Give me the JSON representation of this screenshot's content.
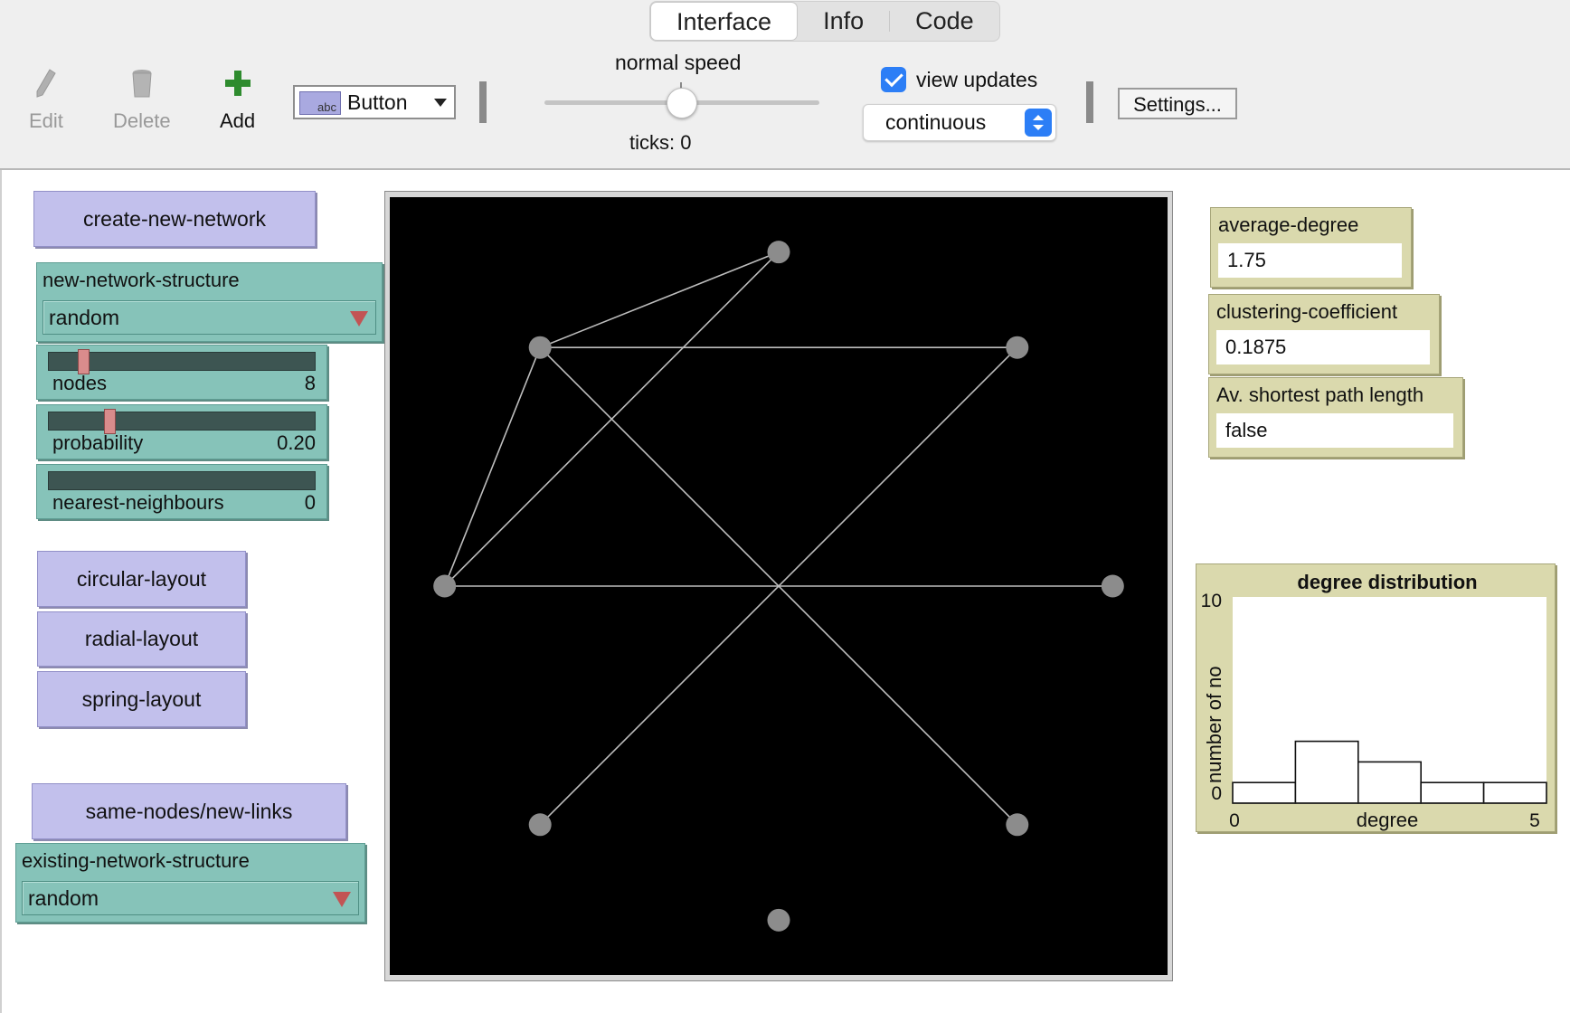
{
  "tabs": [
    {
      "label": "Interface"
    },
    {
      "label": "Info"
    },
    {
      "label": "Code"
    }
  ],
  "toolbar": {
    "edit_label": "Edit",
    "delete_label": "Delete",
    "add_label": "Add",
    "widget_type": "Button",
    "speed_label": "normal speed",
    "speed_value": 0.5,
    "ticks_label": "ticks: 0",
    "view_updates_label": "view updates",
    "view_updates_checked": true,
    "update_mode": "continuous",
    "settings_label": "Settings..."
  },
  "widgets": {
    "create_button": "create-new-network",
    "new_structure": {
      "label": "new-network-structure",
      "value": "random"
    },
    "nodes": {
      "label": "nodes",
      "value": "8",
      "position": 0.1
    },
    "probability": {
      "label": "probability",
      "value": "0.20",
      "position": 0.2
    },
    "nearest": {
      "label": "nearest-neighbours",
      "value": "0",
      "position": 0.0
    },
    "circular_button": "circular-layout",
    "radial_button": "radial-layout",
    "spring_button": "spring-layout",
    "same_nodes_button": "same-nodes/new-links",
    "existing_structure": {
      "label": "existing-network-structure",
      "value": "random"
    }
  },
  "monitors": {
    "average_degree": {
      "label": "average-degree",
      "value": "1.75"
    },
    "clustering": {
      "label": "clustering-coefficient",
      "value": "0.1875"
    },
    "shortest_path": {
      "label": "Av. shortest path length",
      "value": "false"
    }
  },
  "network": {
    "node_color": "#8c8c8c",
    "link_color": "#bdbdbd",
    "nodes": [
      {
        "id": "n-top",
        "x": 0.0,
        "y": 14.0
      },
      {
        "id": "n-upper-left",
        "x": -10.0,
        "y": 10.0
      },
      {
        "id": "n-upper-right",
        "x": 10.0,
        "y": 10.0
      },
      {
        "id": "n-left",
        "x": -14.0,
        "y": 0.0
      },
      {
        "id": "n-right",
        "x": 14.0,
        "y": 0.0
      },
      {
        "id": "n-lower-left",
        "x": -10.0,
        "y": -10.0
      },
      {
        "id": "n-lower-right",
        "x": 10.0,
        "y": -10.0
      },
      {
        "id": "n-bottom",
        "x": 0.0,
        "y": -14.0
      }
    ],
    "links": [
      [
        "n-top",
        "n-upper-left"
      ],
      [
        "n-top",
        "n-left"
      ],
      [
        "n-upper-left",
        "n-upper-right"
      ],
      [
        "n-upper-left",
        "n-left"
      ],
      [
        "n-upper-left",
        "n-lower-right"
      ],
      [
        "n-upper-right",
        "n-lower-left"
      ],
      [
        "n-left",
        "n-right"
      ]
    ]
  },
  "chart_data": {
    "type": "bar",
    "title": "degree distribution",
    "xlabel": "degree",
    "ylabel": "number of nodes",
    "ylabel_visible": "number of no",
    "xlim": [
      0,
      5
    ],
    "ylim": [
      0,
      10
    ],
    "x_tick_labels": [
      "0",
      "5"
    ],
    "y_tick_labels": [
      "0",
      "10"
    ],
    "bins": [
      {
        "x0": 0,
        "x1": 1,
        "value": 1
      },
      {
        "x0": 1,
        "x1": 2,
        "value": 3
      },
      {
        "x0": 2,
        "x1": 3,
        "value": 2
      },
      {
        "x0": 3,
        "x1": 4,
        "value": 1
      },
      {
        "x0": 4,
        "x1": 5,
        "value": 1
      }
    ]
  }
}
